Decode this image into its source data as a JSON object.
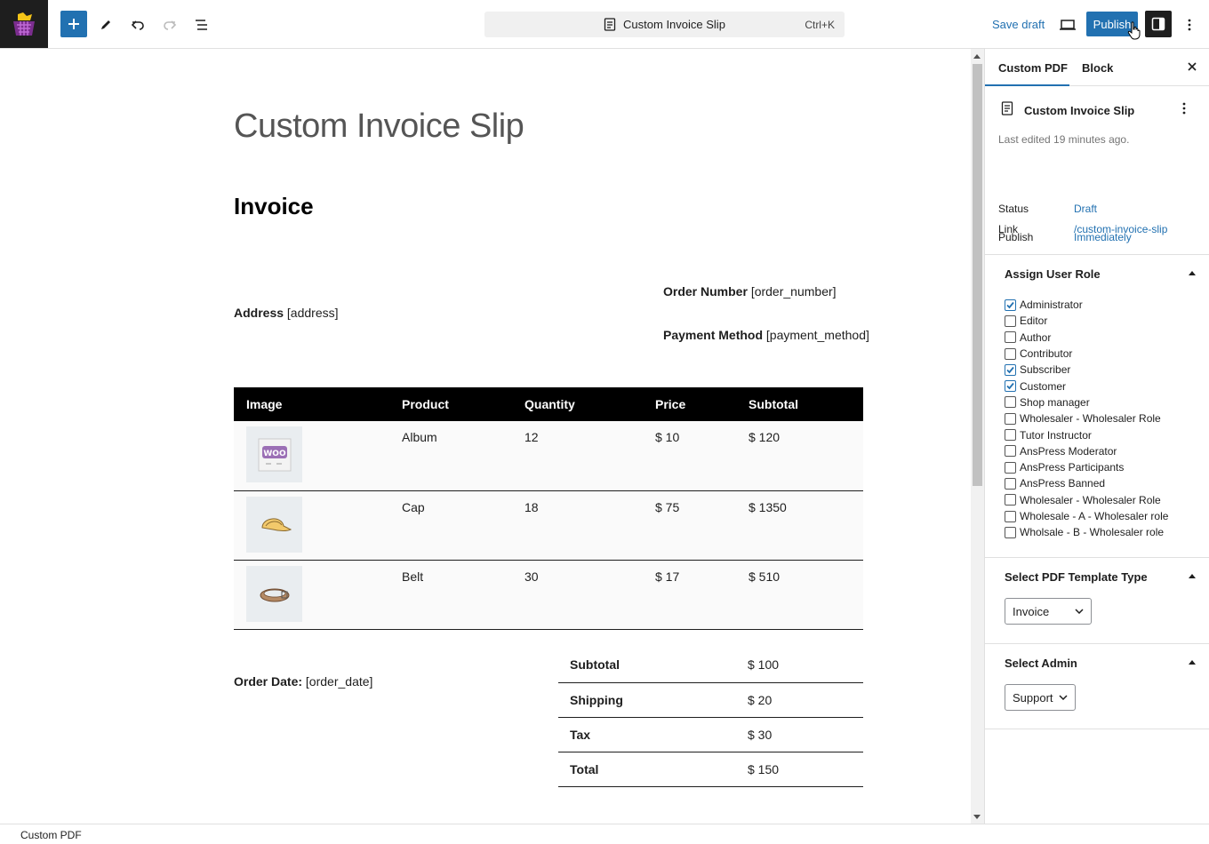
{
  "toolbar": {
    "document_title": "Custom Invoice Slip",
    "shortcut": "Ctrl+K",
    "save_draft_label": "Save draft",
    "publish_label": "Publish"
  },
  "document": {
    "post_title": "Custom Invoice Slip",
    "heading": "Invoice",
    "order_number_label": "Order Number",
    "order_number_value": "[order_number]",
    "address_label": "Address",
    "address_value": "[address]",
    "payment_method_label": "Payment Method",
    "payment_method_value": "[payment_method]",
    "order_date_label": "Order Date:",
    "order_date_value": "[order_date]",
    "table": {
      "headers": [
        "Image",
        "Product",
        "Quantity",
        "Price",
        "Subtotal"
      ],
      "rows": [
        {
          "image": "woo-album-thumbnail",
          "product": "Album",
          "quantity": "12",
          "price": "$ 10",
          "subtotal": "$ 120"
        },
        {
          "image": "cap-thumbnail",
          "product": "Cap",
          "quantity": "18",
          "price": "$ 75",
          "subtotal": "$ 1350"
        },
        {
          "image": "belt-thumbnail",
          "product": "Belt",
          "quantity": "30",
          "price": "$ 17",
          "subtotal": "$ 510"
        }
      ]
    },
    "totals": [
      {
        "label": "Subtotal",
        "value": "$ 100"
      },
      {
        "label": "Shipping",
        "value": "$ 20"
      },
      {
        "label": "Tax",
        "value": "$ 30"
      },
      {
        "label": "Total",
        "value": "$ 150"
      }
    ]
  },
  "sidebar": {
    "tabs": {
      "active": "Custom PDF",
      "block": "Block"
    },
    "summary": {
      "title": "Custom Invoice Slip",
      "last_edited": "Last edited 19 minutes ago.",
      "status_label": "Status",
      "status_value": "Draft",
      "publish_label": "Publish",
      "publish_value": "Immediately",
      "link_label": "Link",
      "link_value": "/custom-invoice-slip"
    },
    "user_roles": {
      "title": "Assign User Role",
      "items": [
        {
          "label": "Administrator",
          "checked": true
        },
        {
          "label": "Editor",
          "checked": false
        },
        {
          "label": "Author",
          "checked": false
        },
        {
          "label": "Contributor",
          "checked": false
        },
        {
          "label": "Subscriber",
          "checked": true
        },
        {
          "label": "Customer",
          "checked": true
        },
        {
          "label": "Shop manager",
          "checked": false
        },
        {
          "label": "Wholesaler - Wholesaler Role",
          "checked": false
        },
        {
          "label": "Tutor Instructor",
          "checked": false
        },
        {
          "label": "AnsPress Moderator",
          "checked": false
        },
        {
          "label": "AnsPress Participants",
          "checked": false
        },
        {
          "label": "AnsPress Banned",
          "checked": false
        },
        {
          "label": "Wholesaler - Wholesaler Role",
          "checked": false
        },
        {
          "label": "Wholesale - A - Wholesaler role",
          "checked": false
        },
        {
          "label": "Wholsale - B - Wholesaler role",
          "checked": false
        }
      ]
    },
    "template_type": {
      "title": "Select PDF Template Type",
      "selected": "Invoice"
    },
    "admin": {
      "title": "Select Admin",
      "selected": "Support"
    }
  },
  "footer": {
    "breadcrumb": "Custom PDF"
  },
  "colors": {
    "accent": "#2271b1",
    "dark": "#1e1e1e",
    "logo_purple": "#7b2d8e",
    "logo_yellow": "#f5c518"
  }
}
